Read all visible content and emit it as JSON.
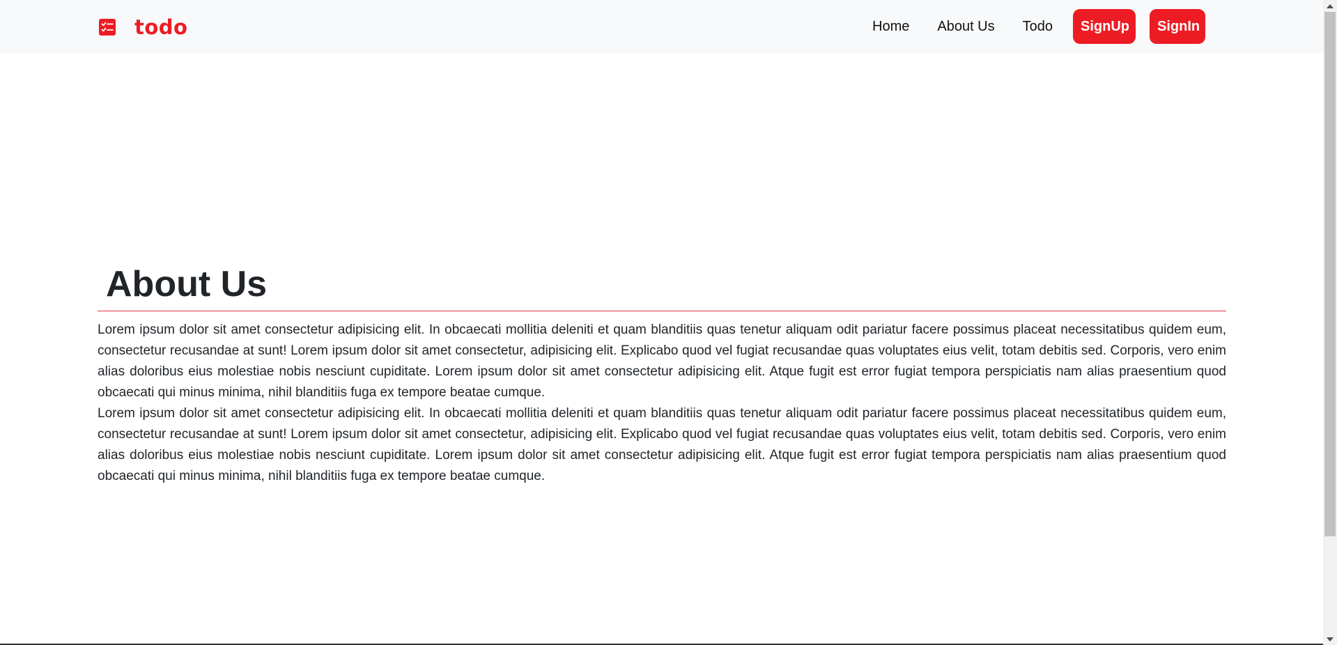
{
  "brand": {
    "name": "todo",
    "color": "#ed1c24"
  },
  "nav": {
    "links": [
      "Home",
      "About Us",
      "Todo"
    ],
    "signup_label": "SignUp",
    "signin_label": "SignIn",
    "accent": "#ed1c24"
  },
  "main": {
    "title": "About Us",
    "paragraphs": [
      "Lorem ipsum dolor sit amet consectetur adipisicing elit. In obcaecati mollitia deleniti et quam blanditiis quas tenetur aliquam odit pariatur facere possimus placeat necessitatibus quidem eum, consectetur recusandae at sunt! Lorem ipsum dolor sit amet consectetur, adipisicing elit. Explicabo quod vel fugiat recusandae quas voluptates eius velit, totam debitis sed. Corporis, vero enim alias doloribus eius molestiae nobis nesciunt cupiditate. Lorem ipsum dolor sit amet consectetur adipisicing elit. Atque fugit est error fugiat tempora perspiciatis nam alias praesentium quod obcaecati qui minus minima, nihil blanditiis fuga ex tempore beatae cumque.",
      "Lorem ipsum dolor sit amet consectetur adipisicing elit. In obcaecati mollitia deleniti et quam blanditiis quas tenetur aliquam odit pariatur facere possimus placeat necessitatibus quidem eum, consectetur recusandae at sunt! Lorem ipsum dolor sit amet consectetur, adipisicing elit. Explicabo quod vel fugiat recusandae quas voluptates eius velit, totam debitis sed. Corporis, vero enim alias doloribus eius molestiae nobis nesciunt cupiditate. Lorem ipsum dolor sit amet consectetur adipisicing elit. Atque fugit est error fugiat tempora perspiciatis nam alias praesentium quod obcaecati qui minus minima, nihil blanditiis fuga ex tempore beatae cumque."
    ]
  },
  "icons": {
    "brand_icon": "checklist-icon",
    "scroll_up": "chevron-up-icon",
    "scroll_down": "chevron-down-icon"
  }
}
